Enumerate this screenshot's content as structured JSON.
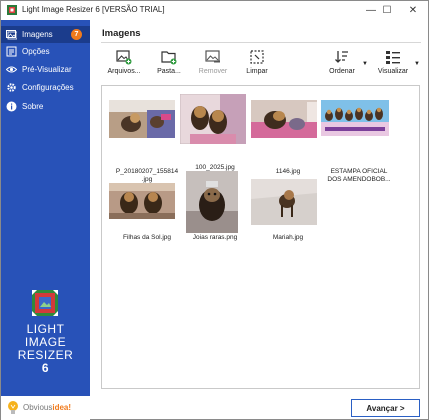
{
  "window": {
    "title": "Light Image Resizer 6  [VERSÃO TRIAL]",
    "minimize": "—",
    "maximize": "☐",
    "close": "✕"
  },
  "sidebar": {
    "items": [
      {
        "label": "Imagens",
        "icon": "images-icon",
        "badge": "7"
      },
      {
        "label": "Opções",
        "icon": "options-icon"
      },
      {
        "label": "Pré-Visualizar",
        "icon": "eye-icon"
      },
      {
        "label": "Configurações",
        "icon": "gear-icon"
      },
      {
        "label": "Sobre",
        "icon": "info-icon"
      }
    ],
    "brand": {
      "line1": "LIGHT",
      "line2": "IMAGE",
      "line3": "RESIZER",
      "version": "6"
    },
    "footer": {
      "text_prefix": "Obvious",
      "text_accent": "idea!"
    }
  },
  "main": {
    "title": "Imagens",
    "toolbar": {
      "files": "Arquivos...",
      "folder": "Pasta...",
      "remove": "Remover",
      "clear": "Limpar",
      "sort": "Ordenar",
      "view": "Visualizar"
    },
    "images": [
      {
        "caption": "P_20180207_155814\n.jpg"
      },
      {
        "caption": "100_2025.jpg"
      },
      {
        "caption": "1146.jpg"
      },
      {
        "caption": "ESTAMPA OFICIAL\nDOS AMENDOBOB..."
      },
      {
        "caption": "Filhas da Sol.jpg"
      },
      {
        "caption": "Joias raras.png"
      },
      {
        "caption": "Mariah.jpg"
      }
    ],
    "next_button": "Avançar >"
  },
  "colors": {
    "sidebar": "#2852b8",
    "sidebar_active": "#1b3c8c",
    "badge": "#f07a1c",
    "next_border": "#2a5fc4"
  }
}
